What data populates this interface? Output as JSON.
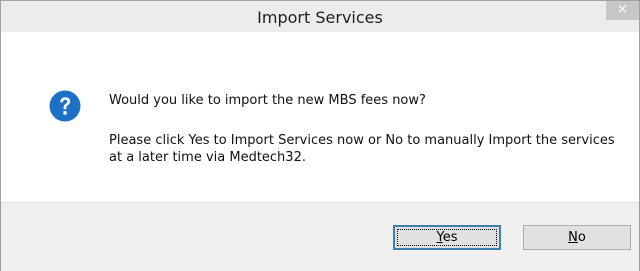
{
  "window": {
    "title": "Import Services",
    "close_glyph": "×"
  },
  "message": {
    "icon": "question-icon",
    "main": "Would you like to import the new MBS fees now?",
    "detail": "Please click Yes to Import Services now or No to manually Import the services at a later time via Medtech32."
  },
  "buttons": {
    "yes": {
      "mnemonic": "Y",
      "rest": "es"
    },
    "no": {
      "mnemonic": "N",
      "rest": "o"
    }
  },
  "colors": {
    "icon_blue": "#1d71c4",
    "footer_bg": "#f0f0f0",
    "default_button_border": "#3c7fb1"
  }
}
